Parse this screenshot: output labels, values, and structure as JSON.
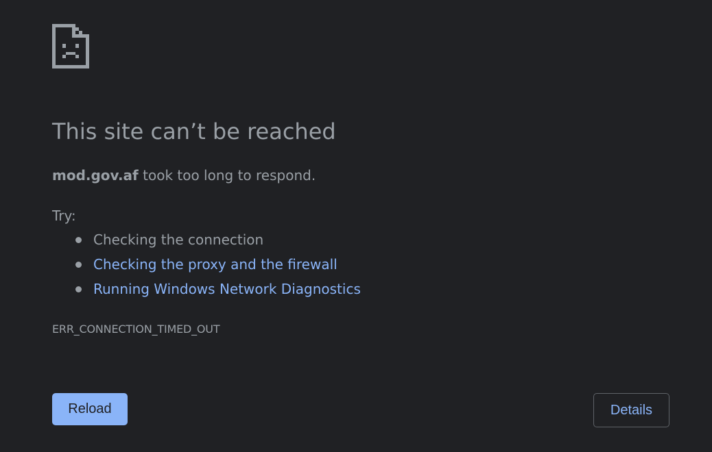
{
  "icon": "sad-page-icon",
  "title": "This site can’t be reached",
  "summary": {
    "host": "mod.gov.af",
    "message": " took too long to respond."
  },
  "try_label": "Try:",
  "suggestions": [
    {
      "text": "Checking the connection",
      "link": false
    },
    {
      "text": "Checking the proxy and the firewall",
      "link": true
    },
    {
      "text": "Running Windows Network Diagnostics",
      "link": true
    }
  ],
  "error_code": "ERR_CONNECTION_TIMED_OUT",
  "buttons": {
    "reload": "Reload",
    "details": "Details"
  },
  "colors": {
    "background": "#202124",
    "text": "#9aa0a6",
    "link": "#8ab4f8",
    "button_primary": "#8ab4f8",
    "button_border": "#5f6368"
  }
}
